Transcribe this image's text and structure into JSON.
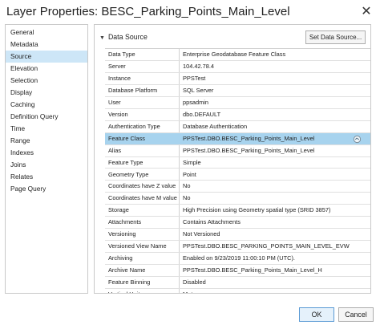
{
  "window": {
    "title": "Layer Properties: BESC_Parking_Points_Main_Level",
    "close_glyph": "✕"
  },
  "nav": {
    "items": [
      "General",
      "Metadata",
      "Source",
      "Elevation",
      "Selection",
      "Display",
      "Caching",
      "Definition Query",
      "Time",
      "Range",
      "Indexes",
      "Joins",
      "Relates",
      "Page Query"
    ],
    "selected": "Source"
  },
  "source": {
    "section_title": "Data Source",
    "set_button_label": "Set Data Source...",
    "rows": [
      {
        "key": "Data Type",
        "value": "Enterprise Geodatabase Feature Class"
      },
      {
        "key": "Server",
        "value": "104.42.78.4"
      },
      {
        "key": "Instance",
        "value": "PPSTest"
      },
      {
        "key": "Database Platform",
        "value": "SQL Server"
      },
      {
        "key": "User",
        "value": "ppsadmin"
      },
      {
        "key": "Version",
        "value": "dbo.DEFAULT"
      },
      {
        "key": "Authentication Type",
        "value": "Database Authentication"
      },
      {
        "key": "Feature Class",
        "value": "PPSTest.DBO.BESC_Parking_Points_Main_Level"
      },
      {
        "key": "Alias",
        "value": "PPSTest.DBO.BESC_Parking_Points_Main_Level"
      },
      {
        "key": "Feature Type",
        "value": "Simple"
      },
      {
        "key": "Geometry Type",
        "value": "Point"
      },
      {
        "key": "Coordinates have Z value",
        "value": "No"
      },
      {
        "key": "Coordinates have M value",
        "value": "No"
      },
      {
        "key": "Storage",
        "value": "High Precision using Geometry spatial type (SRID 3857)"
      },
      {
        "key": "Attachments",
        "value": "Contains Attachments"
      },
      {
        "key": "Versioning",
        "value": "Not Versioned"
      },
      {
        "key": "Versioned View Name",
        "value": "PPSTest.DBO.BESC_PARKING_POINTS_MAIN_LEVEL_EVW"
      },
      {
        "key": "Archiving",
        "value": "Enabled on 9/23/2019 11:00:10 PM (UTC)."
      },
      {
        "key": "Archive Name",
        "value": "PPSTest.DBO.BESC_Parking_Points_Main_Level_H"
      },
      {
        "key": "Feature Binning",
        "value": "Disabled"
      },
      {
        "key": "Vertical Units",
        "value": "Meter"
      }
    ],
    "selected_row": "Feature Class"
  },
  "footer": {
    "ok_label": "OK",
    "cancel_label": "Cancel"
  },
  "colors": {
    "nav_selected": "#cde6f7",
    "row_selected": "#a7d3ee",
    "ok_border": "#5b9bd5"
  },
  "icons": {
    "section_toggle": "chevron-down-icon",
    "feature_class_action": "catalog-icon"
  }
}
